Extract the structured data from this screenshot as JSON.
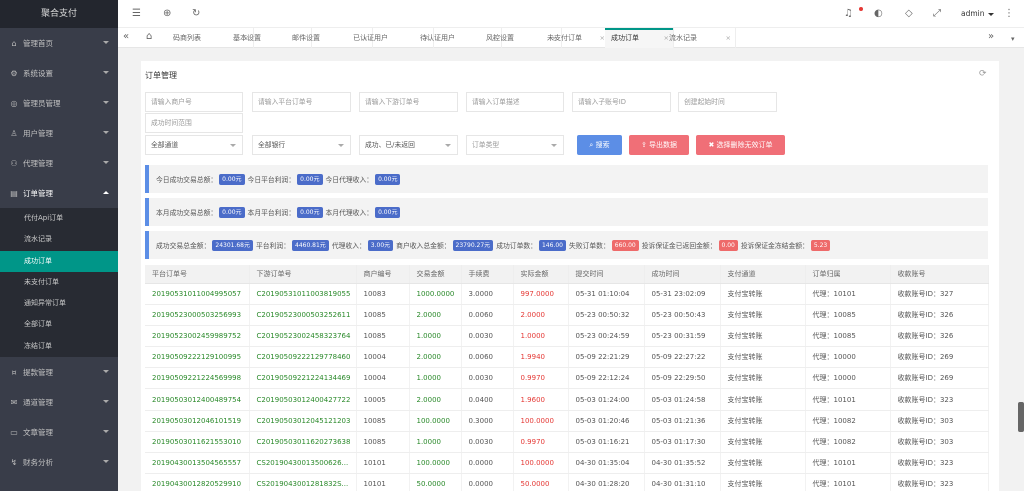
{
  "app": {
    "title": "聚合支付"
  },
  "sidebar": {
    "top_items": [
      {
        "label": "管理首页",
        "icon": "home-icon"
      },
      {
        "label": "系统设置",
        "icon": "gear-icon"
      },
      {
        "label": "管理员管理",
        "icon": "admin-icon"
      },
      {
        "label": "用户管理",
        "icon": "user-icon"
      },
      {
        "label": "代理管理",
        "icon": "agent-icon"
      }
    ],
    "open_item": {
      "label": "订单管理",
      "icon": "order-icon"
    },
    "sub_items": [
      "代付Api订单",
      "流水记录",
      "成功订单",
      "未支付订单",
      "通知异常订单",
      "全部订单",
      "冻结订单"
    ],
    "bottom_items": [
      {
        "label": "提款管理",
        "icon": "withdraw-icon"
      },
      {
        "label": "通道管理",
        "icon": "channel-icon"
      },
      {
        "label": "文章管理",
        "icon": "article-icon"
      },
      {
        "label": "财务分析",
        "icon": "finance-icon"
      }
    ]
  },
  "header": {
    "user": "admin"
  },
  "tabs": [
    "码商列表",
    "基本设置",
    "邮件设置",
    "已认证用户",
    "待认证用户",
    "风控设置",
    "未支付订单",
    "成功订单",
    "流水记录"
  ],
  "panel": {
    "title": "订单管理",
    "filters": {
      "merchant_no": "请输入商户号",
      "platform_order": "请输入平台订单号",
      "downstream_order": "请输入下游订单号",
      "order_desc": "请输入订单描述",
      "sub_account": "请输入子账号ID",
      "create_time": "创建起始时间",
      "success_time": "成功时间范围",
      "channel": "全部通道",
      "bank": "全部银行",
      "status": "成功、已/未返回",
      "order_type": "订单类型"
    },
    "buttons": {
      "search": "搜索",
      "export": "导出数据",
      "delete_invalid": "选择删除无效订单"
    },
    "today": {
      "l1": "今日成功交易总额：",
      "v1": "0.00元",
      "l2": "今日平台利润：",
      "v2": "0.00元",
      "l3": "今日代理收入：",
      "v3": "0.00元"
    },
    "month": {
      "l1": "本月成功交易总额：",
      "v1": "0.00元",
      "l2": "本月平台利润：",
      "v2": "0.00元",
      "l3": "本月代理收入：",
      "v3": "0.00元"
    },
    "total": {
      "l1": "成功交易总金额：",
      "v1": "24301.68元",
      "l2": "平台利润：",
      "v2": "4460.81元",
      "l3": "代理收入：",
      "v3": "3.00元",
      "l4": "商户收入总金额：",
      "v4": "23790.27元",
      "l5": "成功订单数：",
      "v5": "146.00",
      "l6": "失败订单数：",
      "v6": "660.00",
      "l7": "投诉保证金已返回金额：",
      "v7": "0.00",
      "l8": "投诉保证金冻结金额：",
      "v8": "5.23"
    }
  },
  "table": {
    "headers": [
      "平台订单号",
      "下游订单号",
      "商户编号",
      "交易金额",
      "手续费",
      "实际金额",
      "提交时间",
      "成功时间",
      "支付通道",
      "订单归属",
      "收款账号"
    ],
    "rows": [
      [
        "20190531011004995057",
        "C20190531011003819055",
        "10083",
        "1000.0000",
        "3.0000",
        "997.0000",
        "05-31 01:10:04",
        "05-31 23:02:09",
        "支付宝转账",
        "代理：10101",
        "收款账号ID：327"
      ],
      [
        "20190523000503256993",
        "C20190523000503252611",
        "10085",
        "2.0000",
        "0.0060",
        "2.0000",
        "05-23 00:50:32",
        "05-23 00:50:43",
        "支付宝转账",
        "代理：10085",
        "收款账号ID：326"
      ],
      [
        "20190523002459989752",
        "C20190523002458323764",
        "10085",
        "1.0000",
        "0.0030",
        "1.0000",
        "05-23 00:24:59",
        "05-23 00:31:59",
        "支付宝转账",
        "代理：10085",
        "收款账号ID：326"
      ],
      [
        "20190509222129100995",
        "C20190509222129778460",
        "10004",
        "2.0000",
        "0.0060",
        "1.9940",
        "05-09 22:21:29",
        "05-09 22:27:22",
        "支付宝转账",
        "代理：10000",
        "收款账号ID：269"
      ],
      [
        "20190509221224569998",
        "C20190509221224134469",
        "10004",
        "1.0000",
        "0.0030",
        "0.9970",
        "05-09 22:12:24",
        "05-09 22:29:50",
        "支付宝转账",
        "代理：10000",
        "收款账号ID：269"
      ],
      [
        "20190503012400489754",
        "C20190503012400427722",
        "10005",
        "2.0000",
        "0.0400",
        "1.9600",
        "05-03 01:24:00",
        "05-03 01:24:58",
        "支付宝转账",
        "代理：10101",
        "收款账号ID：323"
      ],
      [
        "20190503012046101519",
        "C20190503012045121203",
        "10085",
        "100.0000",
        "0.3000",
        "100.0000",
        "05-03 01:20:46",
        "05-03 01:21:36",
        "支付宝转账",
        "代理：10082",
        "收款账号ID：303"
      ],
      [
        "20190503011621553010",
        "C20190503011620273638",
        "10085",
        "1.0000",
        "0.0030",
        "0.9970",
        "05-03 01:16:21",
        "05-03 01:17:30",
        "支付宝转账",
        "代理：10082",
        "收款账号ID：303"
      ],
      [
        "20190430013504565557",
        "CS20190430013500626...",
        "10101",
        "100.0000",
        "0.0000",
        "100.0000",
        "04-30 01:35:04",
        "04-30 01:35:52",
        "支付宝转账",
        "代理：10101",
        "收款账号ID：323"
      ],
      [
        "20190430012820529910",
        "CS2019043001281832S...",
        "10101",
        "50.0000",
        "0.0000",
        "50.0000",
        "04-30 01:28:20",
        "04-30 01:31:10",
        "支付宝转账",
        "代理：10101",
        "收款账号ID：323"
      ]
    ]
  }
}
